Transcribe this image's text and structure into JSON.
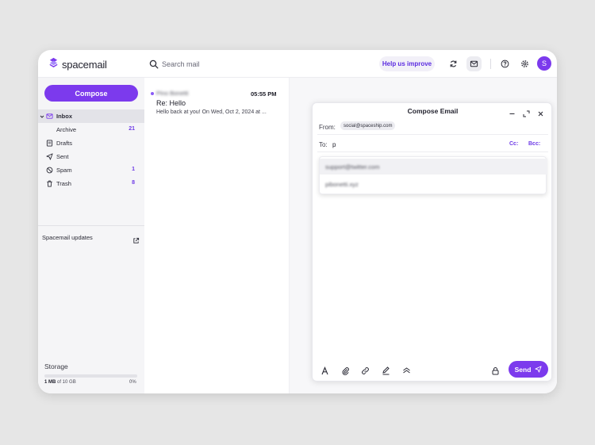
{
  "app": {
    "name": "spacemail"
  },
  "header": {
    "search_placeholder": "Search mail",
    "help_label": "Help us improve",
    "avatar_initial": "S"
  },
  "sidebar": {
    "compose_label": "Compose",
    "items": [
      {
        "label": "Inbox",
        "count": ""
      },
      {
        "label": "Archive",
        "count": "21"
      },
      {
        "label": "Drafts",
        "count": ""
      },
      {
        "label": "Sent",
        "count": ""
      },
      {
        "label": "Spam",
        "count": "1"
      },
      {
        "label": "Trash",
        "count": "8"
      }
    ],
    "updates_label": "Spacemail updates",
    "storage": {
      "label": "Storage",
      "used": "1 MB",
      "of_text": "of 10 GB",
      "percent": "0%",
      "fraction": 0.0
    }
  },
  "messages": [
    {
      "sender": "Pino Bonetti",
      "time": "05:55 PM",
      "subject": "Re: Hello",
      "preview": "Hello back at you! On Wed, Oct 2, 2024 at ..."
    }
  ],
  "compose": {
    "title": "Compose Email",
    "from_label": "From:",
    "from_address": "social@spaceship.com",
    "to_label": "To:",
    "to_value": "p",
    "cc_label": "Cc:",
    "bcc_label": "Bcc:",
    "suggestions": [
      "support@twitter.com",
      "pibonetti.xyz"
    ],
    "send_label": "Send"
  },
  "colors": {
    "accent": "#7c3aed",
    "background": "#e6e6e6"
  },
  "icons": [
    "logo-icon",
    "search-icon",
    "refresh-icon",
    "mail-icon",
    "help-icon",
    "gear-icon",
    "chevron-down-icon",
    "inbox-icon",
    "drafts-icon",
    "send-icon",
    "spam-icon",
    "trash-icon",
    "external-link-icon",
    "minimize-icon",
    "expand-icon",
    "close-icon",
    "text-format-icon",
    "attachment-icon",
    "link-icon",
    "signature-icon",
    "layers-icon",
    "lock-icon"
  ]
}
